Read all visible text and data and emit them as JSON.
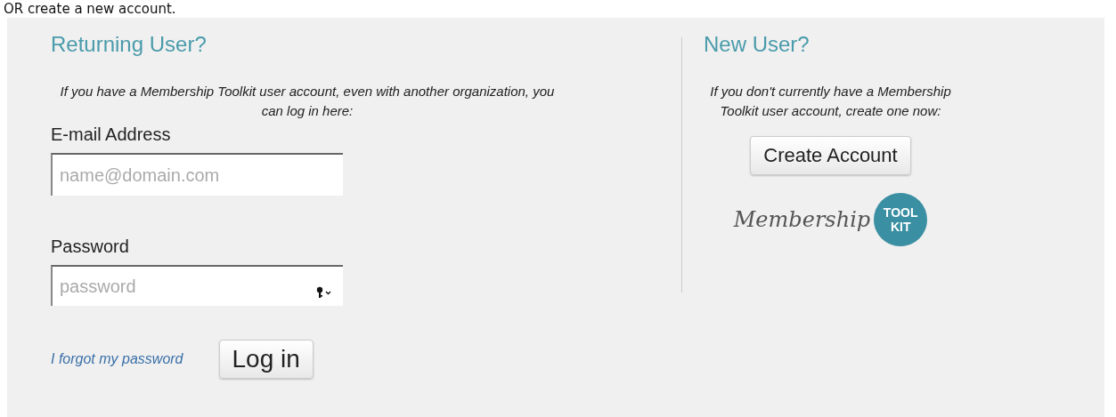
{
  "top_text": "OR create a new account.",
  "returning": {
    "heading": "Returning User?",
    "description": "If you have a Membership Toolkit user account, even with another organization, you can log in here:",
    "email": {
      "label": "E-mail Address",
      "placeholder": "name@domain.com"
    },
    "password": {
      "label": "Password",
      "placeholder": "password"
    },
    "forgot_link": "I forgot my password",
    "login_button": "Log in"
  },
  "new_user": {
    "heading": "New User?",
    "description": "If you don't currently have a Membership Toolkit user account, create one now:",
    "create_button": "Create Account",
    "logo": {
      "script": "Membership",
      "badge_lines": [
        "TOOL",
        "KIT"
      ]
    }
  }
}
